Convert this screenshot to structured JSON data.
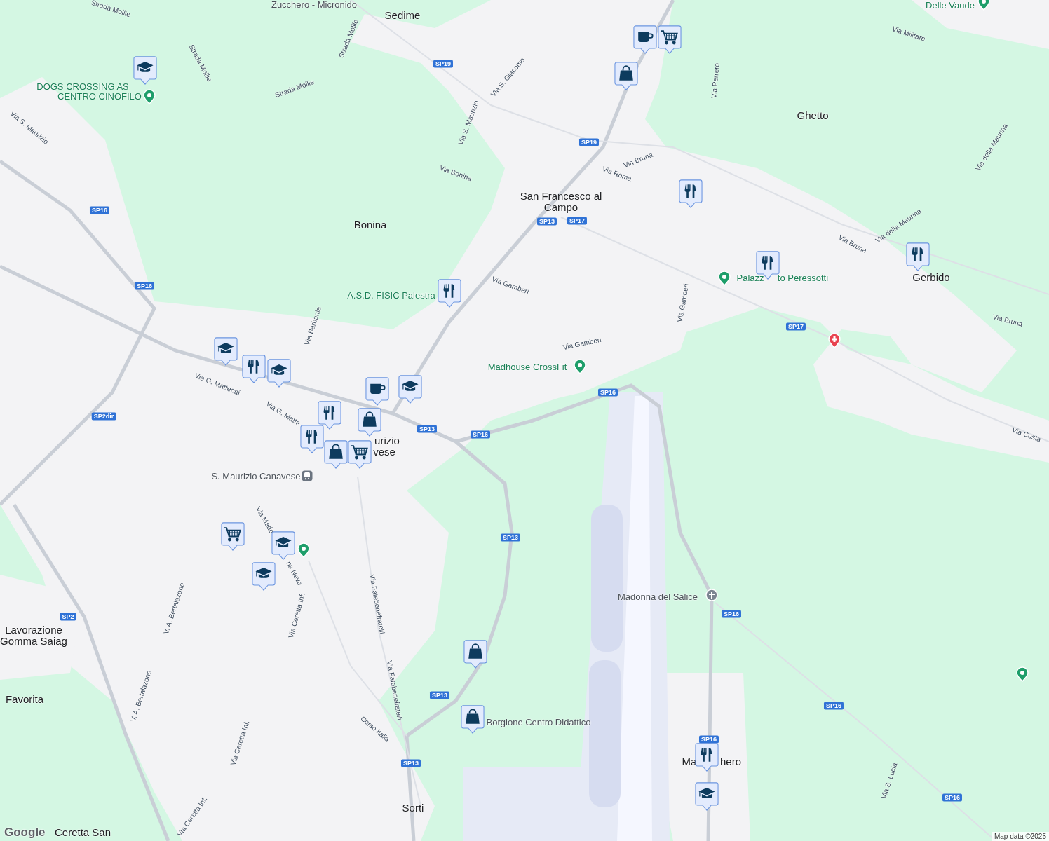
{
  "map": {
    "place_labels": [
      "Sedime",
      "Ghetto",
      "San Francesco al Campo",
      "Bonina",
      "Gerbido",
      "urizio",
      "vese",
      "Lavorazione Gomma Saiag",
      "Favorita",
      "Sorti",
      "Ma",
      "hero",
      "Ceretta San"
    ],
    "poi_labels": [
      {
        "text": "Zucchero - Micronido",
        "kind": "grey"
      },
      {
        "text": "Delle Vaude",
        "kind": "green"
      },
      {
        "text": "DOGS CROSSING AS",
        "kind": "green"
      },
      {
        "text": "CENTRO CINOFILO",
        "kind": "green"
      },
      {
        "text": "A.S.D. FISIC Palestra",
        "kind": "green"
      },
      {
        "text": "Madhouse CrossFit",
        "kind": "green"
      },
      {
        "text": "Palazz",
        "kind": "green"
      },
      {
        "text": "to Peressotti",
        "kind": "green"
      },
      {
        "text": "S. Maurizio Canavese",
        "kind": "grey"
      },
      {
        "text": "Madonna del Salice",
        "kind": "grey"
      },
      {
        "text": "Borgione Centro Didattico",
        "kind": "grey"
      }
    ],
    "road_labels": [
      "Strada Mollie",
      "Strada Mollie",
      "Strada Mollie",
      "Strada Mollie",
      "Via S. Maurizio",
      "Via S. Maurizio",
      "Via S. Giacomo",
      "Via Perrero",
      "Via Militare",
      "Via Bonina",
      "Via Roma",
      "Via Bruna",
      "Via Bruna",
      "Via Bruna",
      "Via della Maurina",
      "Via della Maurina",
      "Via Gamberi",
      "Via Gamberi",
      "Via Gamberi",
      "Via Barbania",
      "Via G. Matteotti",
      "Via G. Matte",
      "Via Mado",
      "na Neve",
      "Via Ceretta Inf.",
      "Via Ceretta Inf.",
      "Via Ceretta Inf.",
      "V. A. Bertalazone",
      "V. A. Bertalazone",
      "Via Fatebenefratelli",
      "Via Fatebenefratelli",
      "Corso Italia",
      "Via S. Lucia",
      "Via Costa"
    ],
    "road_shields": [
      "SP19",
      "SP19",
      "SP16",
      "SP16",
      "SP13",
      "SP17",
      "SP17",
      "SP2dir",
      "SP13",
      "SP16",
      "SP16",
      "SP13",
      "SP2",
      "SP16",
      "SP13",
      "SP16",
      "SP13",
      "SP16",
      "SP16"
    ]
  },
  "markers": [
    {
      "kind": "school"
    },
    {
      "kind": "cafe"
    },
    {
      "kind": "cart"
    },
    {
      "kind": "shop"
    },
    {
      "kind": "restaurant"
    },
    {
      "kind": "restaurant"
    },
    {
      "kind": "restaurant"
    },
    {
      "kind": "restaurant"
    },
    {
      "kind": "school"
    },
    {
      "kind": "restaurant"
    },
    {
      "kind": "school"
    },
    {
      "kind": "cafe"
    },
    {
      "kind": "school"
    },
    {
      "kind": "restaurant"
    },
    {
      "kind": "shop"
    },
    {
      "kind": "restaurant"
    },
    {
      "kind": "shop"
    },
    {
      "kind": "cart"
    },
    {
      "kind": "cart"
    },
    {
      "kind": "school"
    },
    {
      "kind": "school"
    },
    {
      "kind": "shop"
    },
    {
      "kind": "shop"
    },
    {
      "kind": "restaurant"
    },
    {
      "kind": "school"
    }
  ],
  "logo": "Google",
  "attribution": "Map data ©2025"
}
